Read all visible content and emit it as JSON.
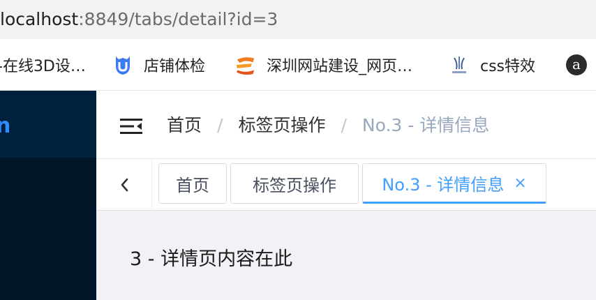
{
  "browser": {
    "url_host": "localhost",
    "url_path": ":8849/tabs/detail?id=3"
  },
  "bookmarks": [
    {
      "label": "-在线3D设…",
      "icon": "none"
    },
    {
      "label": "店铺体检",
      "icon": "shield-badge-icon",
      "color": "#3d7af5"
    },
    {
      "label": "深圳网站建设_网页…",
      "icon": "e-logo-icon",
      "color": "#f07c1e"
    },
    {
      "label": "css特效",
      "icon": "css-inspiration-icon"
    },
    {
      "label": "a",
      "icon": "a-circle-icon"
    }
  ],
  "sidebar": {
    "logo_fragment": "n",
    "accent": "#2f8cff"
  },
  "header": {
    "breadcrumb": [
      "首页",
      "标签页操作",
      "No.3 - 详情信息"
    ],
    "separator": "/"
  },
  "tabs": {
    "items": [
      {
        "label": "首页",
        "active": false
      },
      {
        "label": "标签页操作",
        "active": false
      },
      {
        "label": "No.3 - 详情信息",
        "active": true,
        "close": "×"
      }
    ],
    "active_color": "#409eff"
  },
  "content": {
    "text": "3 - 详情页内容在此"
  }
}
